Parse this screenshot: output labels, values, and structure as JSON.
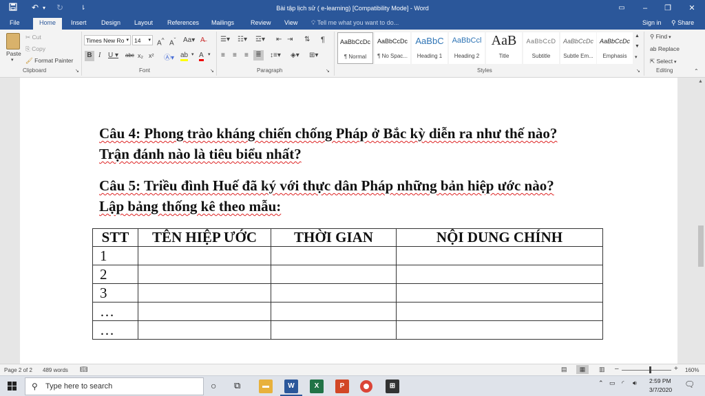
{
  "titlebar": {
    "title": "Bài tập lịch sử ( e-learning) [Compatibility Mode] - Word",
    "save_icon": "floppy-disk",
    "undo_icon": "undo-arrow",
    "redo_icon": "redo-arrow",
    "customize_icon": "customize-qat",
    "ribbon_display_icon": "ribbon-display-options",
    "minimize": "–",
    "restore": "❐",
    "close": "✕"
  },
  "tabs": [
    "File",
    "Home",
    "Insert",
    "Design",
    "Layout",
    "References",
    "Mailings",
    "Review",
    "View"
  ],
  "tell_me": "Tell me what you want to do...",
  "sign_in": "Sign in",
  "share": "Share",
  "ribbon": {
    "clipboard": {
      "group": "Clipboard",
      "paste": "Paste",
      "cut": "Cut",
      "copy": "Copy",
      "format_painter": "Format Painter"
    },
    "font": {
      "group": "Font",
      "font_name": "Times New Ro",
      "font_size": "14"
    },
    "paragraph": {
      "group": "Paragraph"
    },
    "styles": {
      "group": "Styles",
      "items": [
        {
          "preview": "AaBbCcDc",
          "name": "¶ Normal"
        },
        {
          "preview": "AaBbCcDc",
          "name": "¶ No Spac..."
        },
        {
          "preview": "AaBbC",
          "name": "Heading 1"
        },
        {
          "preview": "AaBbCcl",
          "name": "Heading 2"
        },
        {
          "preview": "AaB",
          "name": "Title"
        },
        {
          "preview": "AaBbCcD",
          "name": "Subtitle"
        },
        {
          "preview": "AaBbCcDc",
          "name": "Subtle Em..."
        },
        {
          "preview": "AaBbCcDc",
          "name": "Emphasis"
        }
      ]
    },
    "editing": {
      "group": "Editing",
      "find": "Find",
      "replace": "Replace",
      "select": "Select"
    }
  },
  "document": {
    "q4_line1": "Câu 4: Phong trào kháng chiến chống Pháp ở Bắc kỳ diễn ra như thế nào?",
    "q4_line2": "Trận đánh nào là tiêu biểu nhất?",
    "q5_line1": "Câu 5: Triều đình Huế đã ký với thực dân Pháp những bản hiệp ước nào?",
    "q5_line2": "Lập bảng thống kê theo mẫu:",
    "table": {
      "headers": [
        "STT",
        "TÊN HIỆP ƯỚC",
        "THỜI GIAN",
        "NỘI DUNG CHÍNH"
      ],
      "rows": [
        [
          "1",
          "",
          "",
          ""
        ],
        [
          "2",
          "",
          "",
          ""
        ],
        [
          "3",
          "",
          "",
          ""
        ],
        [
          "…",
          "",
          "",
          ""
        ],
        [
          "…",
          "",
          "",
          ""
        ]
      ]
    }
  },
  "status": {
    "page": "Page 2 of 2",
    "words": "489 words",
    "zoom": "160%"
  },
  "taskbar": {
    "search_placeholder": "Type here to search",
    "time": "2:59 PM",
    "date": "3/7/2020"
  },
  "colors": {
    "title_bar": "#2b579a",
    "word_icon": "#2b579a",
    "excel_icon": "#217346",
    "powerpoint_icon": "#d24726",
    "spell_underline": "#d22222"
  }
}
